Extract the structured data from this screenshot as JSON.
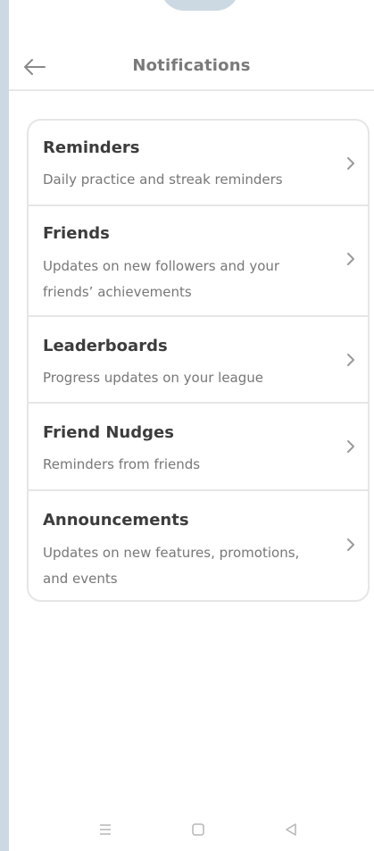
{
  "header": {
    "title": "Notifications",
    "back_icon": "arrow-left-icon"
  },
  "items": [
    {
      "title": "Reminders",
      "description": "Daily practice and streak reminders"
    },
    {
      "title": "Friends",
      "description": "Updates on new followers and your friends’ achievements"
    },
    {
      "title": "Leaderboards",
      "description": "Progress updates on your league"
    },
    {
      "title": "Friend Nudges",
      "description": "Reminders from friends"
    },
    {
      "title": "Announcements",
      "description": "Updates on new features, promotions, and events"
    }
  ],
  "system_nav": {
    "icons": [
      "menu-icon",
      "home-square-icon",
      "back-triangle-icon"
    ]
  },
  "colors": {
    "title_text": "#3c3c3c",
    "description_text": "#777777",
    "header_text": "#7a7a7a",
    "divider": "#e6e6e6",
    "frame_background": "#cdd9e2"
  }
}
